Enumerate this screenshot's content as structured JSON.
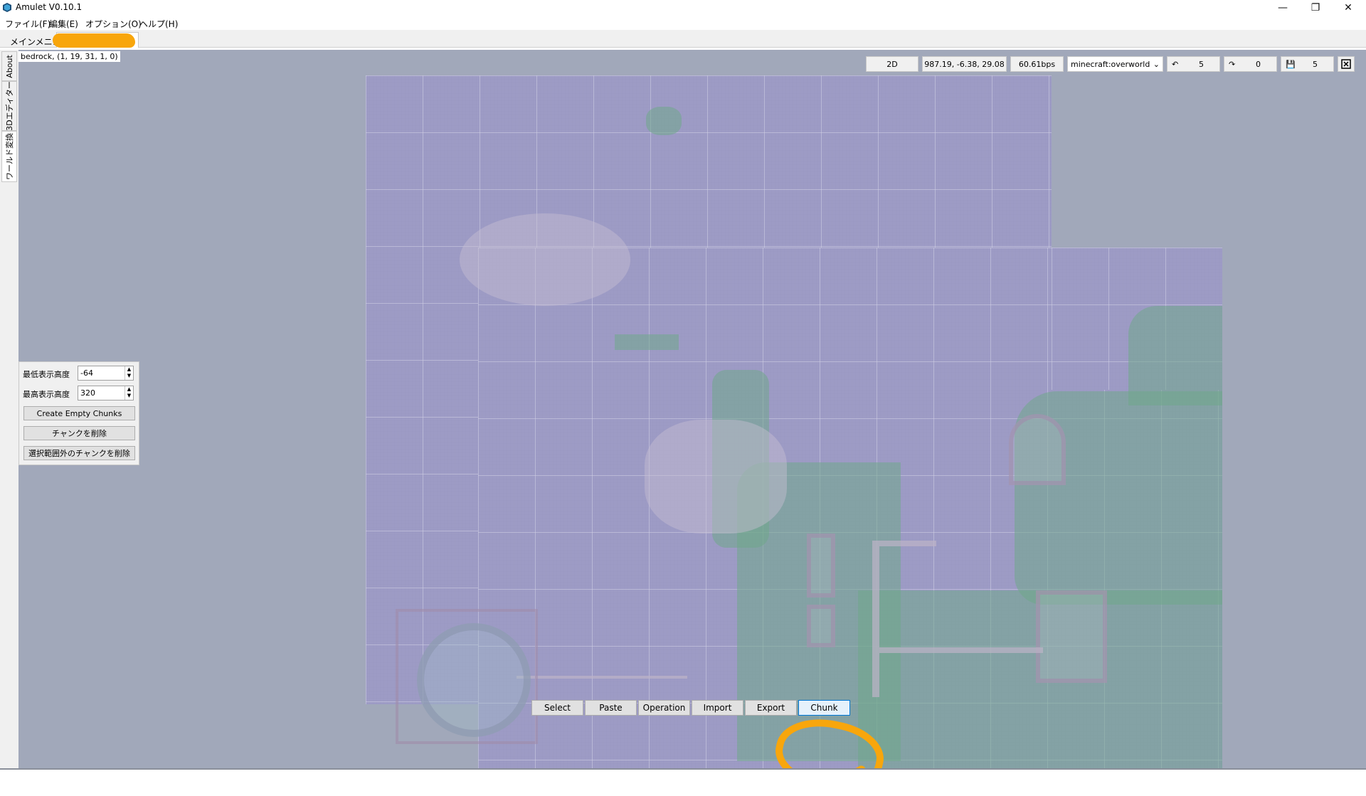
{
  "window": {
    "title": "Amulet V0.10.1",
    "controls": {
      "minimize": "—",
      "maximize": "❐",
      "close": "✕"
    }
  },
  "menu": {
    "items": [
      "ファイル(F)",
      "編集(E)",
      "オプション(O)",
      "ヘルプ(H)"
    ]
  },
  "tabs": {
    "main_menu": "メインメニュー"
  },
  "side_tabs": [
    "About",
    "3Dエディター",
    "ワールド変換"
  ],
  "viewport": {
    "block_info": "bedrock, (1, 19, 31, 1, 0)"
  },
  "toolbar": {
    "view_mode": "2D",
    "coordinates": "987.19, -6.38, 29.08",
    "speed": "60.61bps",
    "dimension": "minecraft:overworld",
    "undo_count": "5",
    "redo_count": "0",
    "save_count": "5"
  },
  "panel": {
    "min_height_label": "最低表示高度",
    "min_height_value": "-64",
    "max_height_label": "最高表示高度",
    "max_height_value": "320",
    "create_empty_chunks": "Create Empty Chunks",
    "delete_chunks": "チャンクを削除",
    "delete_outside_chunks": "選択範囲外のチャンクを削除"
  },
  "tools": {
    "select": "Select",
    "paste": "Paste",
    "operation": "Operation",
    "import": "Import",
    "export": "Export",
    "chunk": "Chunk",
    "active": "Chunk"
  },
  "annotations": {
    "highlight_color": "#f8a60c"
  },
  "colors": {
    "viewport_bg": "#a1a8ba",
    "map_tint": "#9d9bc5",
    "terrain_green": "#70a88a"
  }
}
